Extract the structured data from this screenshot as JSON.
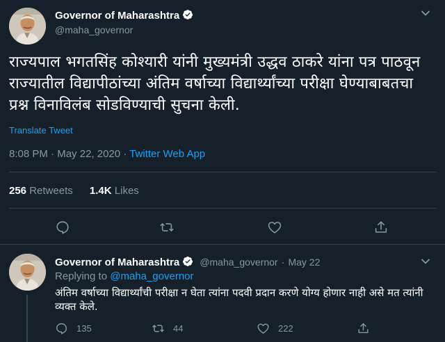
{
  "main_tweet": {
    "author_name": "Governor of Maharashtra",
    "author_handle": "@maha_governor",
    "text": "राज्यपाल भगतसिंह कोश्यारी यांनी मुख्यमंत्री उद्धव ठाकरे यांना पत्र पाठवून राज्यातील विद्यापीठांच्या अंतिम वर्षाच्या विद्यार्थ्यांच्या परीक्षा घेण्याबाबतचा प्रश्न विनाविलंब सोडविण्याची सुचना केली.",
    "translate_label": "Translate Tweet",
    "time": "8:08 PM",
    "separator": "·",
    "date": "May 22, 2020",
    "client": "Twitter Web App",
    "retweets_count": "256",
    "retweets_label": "Retweets",
    "likes_count": "1.4K",
    "likes_label": "Likes"
  },
  "reply_tweet": {
    "author_name": "Governor of Maharashtra",
    "author_handle": "@maha_governor",
    "separator": "·",
    "date": "May 22",
    "replying_prefix": "Replying to",
    "replying_handle": "@maha_governor",
    "text": "अंतिम वर्षाच्या विद्यार्थ्यांची परीक्षा न घेता त्यांना पदवी प्रदान करणे योग्य होणार नाही असे मत त्यांनी व्यक्त केले.",
    "reply_count": "135",
    "retweet_count": "44",
    "like_count": "222"
  },
  "icons": {
    "more": "chevron-down-icon",
    "verified": "verified-badge-icon",
    "reply": "reply-icon",
    "retweet": "retweet-icon",
    "like": "like-icon",
    "share": "share-icon"
  },
  "colors": {
    "background": "#15202b",
    "accent": "#1da1f2",
    "secondary_text": "#8899a6",
    "divider": "#38444d"
  }
}
